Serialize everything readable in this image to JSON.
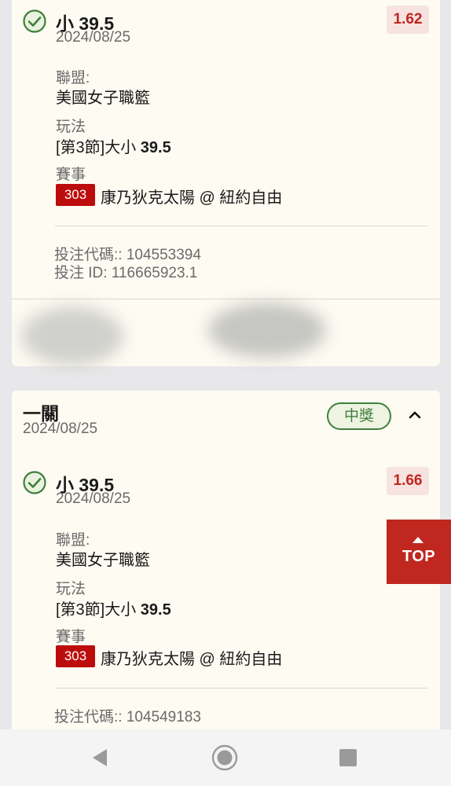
{
  "bets": [
    {
      "selection": "小 39.5",
      "date": "2024/08/25",
      "odds": "1.62",
      "league_label": "聯盟:",
      "league": "美國女子職籃",
      "market_label": "玩法",
      "market_prefix": "[第3節]大小 ",
      "market_line": "39.5",
      "event_label": "賽事",
      "event_number": "303",
      "event_name": "康乃狄克太陽 @ 紐約自由",
      "bet_code": "投注代碼:: 104553394",
      "bet_id": "投注 ID: 116665923.1"
    },
    {
      "selection": "小 39.5",
      "date": "2024/08/25",
      "odds": "1.66",
      "league_label": "聯盟:",
      "league": "美國女子職籃",
      "market_label": "玩法",
      "market_prefix": "[第3節]大小 ",
      "market_line": "39.5",
      "event_label": "賽事",
      "event_number": "303",
      "event_name": "康乃狄克太陽 @ 紐約自由",
      "bet_code": "投注代碼:: 104549183"
    }
  ],
  "parlay": {
    "title": "一關",
    "date": "2024/08/25",
    "status": "中獎"
  },
  "top_button": "TOP",
  "colors": {
    "accent_red": "#c0271f",
    "win_green": "#3d7f3d",
    "card_bg": "#fdfbf2",
    "page_bg": "#e8e8ea"
  },
  "icons": [
    "check-circle-icon",
    "chevron-up-icon",
    "back-icon",
    "home-icon",
    "recents-icon"
  ]
}
